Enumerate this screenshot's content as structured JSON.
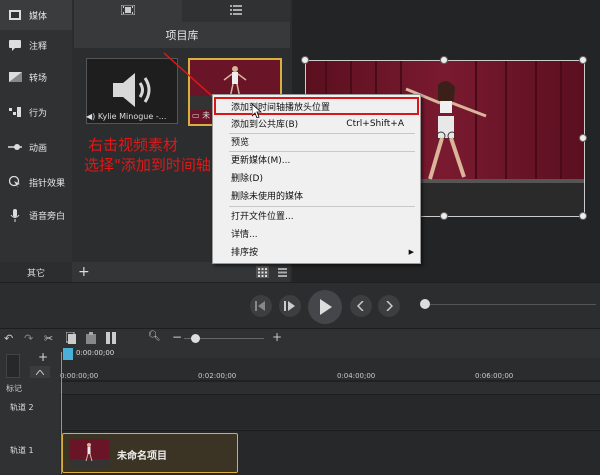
{
  "sidebar": {
    "items": [
      {
        "name": "media",
        "label": "媒体",
        "icon": "media-icon"
      },
      {
        "name": "annotations",
        "label": "注释",
        "icon": "annotation-icon"
      },
      {
        "name": "transitions",
        "label": "转场",
        "icon": "transition-icon"
      },
      {
        "name": "behaviors",
        "label": "行为",
        "icon": "behavior-icon"
      },
      {
        "name": "animations",
        "label": "动画",
        "icon": "animation-icon"
      },
      {
        "name": "cursor",
        "label": "指针效果",
        "icon": "cursor-icon"
      },
      {
        "name": "voice",
        "label": "语音旁白",
        "icon": "microphone-icon"
      }
    ],
    "more_label": "其它"
  },
  "library": {
    "title": "项目库",
    "audio_clip": "Kylie Minogue -...",
    "video_clip": "未"
  },
  "context_menu": {
    "items": [
      {
        "label": "添加到时间轴播放头位置",
        "shortcut": ""
      },
      {
        "label": "添加到公共库(B)",
        "shortcut": "Ctrl+Shift+A"
      },
      {
        "label": "预览",
        "shortcut": ""
      },
      {
        "label": "更新媒体(M)...",
        "shortcut": ""
      },
      {
        "label": "删除(D)",
        "shortcut": ""
      },
      {
        "label": "删除未使用的媒体",
        "shortcut": ""
      },
      {
        "label": "打开文件位置...",
        "shortcut": ""
      },
      {
        "label": "详情...",
        "shortcut": ""
      },
      {
        "label": "排序按",
        "shortcut": ""
      }
    ]
  },
  "annotation": {
    "line1": "右击视频素材",
    "line2": "选择\"添加到时间轴\""
  },
  "timeline": {
    "playhead_time": "0:00:00;00",
    "ruler_ticks": [
      "0:00:00;00",
      "0:02:00;00",
      "0:04:00;00",
      "0:06:00;00"
    ],
    "markers_label": "标记",
    "track2_label": "轨道 2",
    "track1_label": "轨道 1",
    "clip_label": "未命名项目"
  },
  "colors": {
    "accent_red": "#e01818",
    "clip_border": "#d8b040",
    "playhead": "#4ab0d8"
  }
}
